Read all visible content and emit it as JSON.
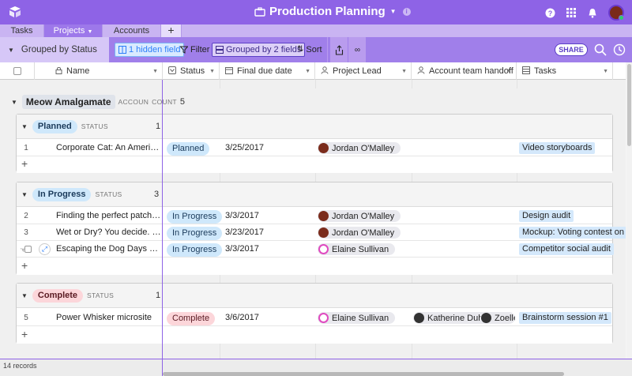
{
  "app": {
    "title": "Production Planning",
    "colors": {
      "topbar": "#8e63e6",
      "accent": "#2d7ff9",
      "frozen_line": "#8e63e6"
    }
  },
  "tabs": [
    {
      "label": "Tasks"
    },
    {
      "label": "Projects",
      "active": true
    },
    {
      "label": "Accounts"
    }
  ],
  "tab_add": "+",
  "toolbar": {
    "view_name": "Grouped by Status",
    "hidden_fields": "1 hidden field",
    "filter": "Filter",
    "grouped": "Grouped by 2 fields",
    "sort": "Sort",
    "share": "SHARE"
  },
  "columns": [
    {
      "label": "Name",
      "icon": "lock-icon"
    },
    {
      "label": "Status",
      "icon": "single-select-icon"
    },
    {
      "label": "Final due date",
      "icon": "calendar-icon"
    },
    {
      "label": "Project Lead",
      "icon": "user-icon"
    },
    {
      "label": "Account team handoff",
      "icon": "user-icon"
    },
    {
      "label": "Tasks",
      "icon": "linked-records-icon"
    }
  ],
  "top_group": {
    "label": "Meow Amalgamate",
    "field": "ACCOUN",
    "count_label": "COUNT",
    "count": "5"
  },
  "groups": [
    {
      "label": "Planned",
      "field": "STATUS",
      "count": "1",
      "color": "blue",
      "rows": [
        {
          "num": "1",
          "name": "Corporate Cat: An American L...",
          "status": "Planned",
          "date": "3/25/2017",
          "lead": "Jordan O'Malley",
          "lead_avatar": "dark",
          "handoff": [],
          "task": "Video storyboards"
        }
      ]
    },
    {
      "label": "In Progress",
      "field": "STATUS",
      "count": "3",
      "color": "blue",
      "rows": [
        {
          "num": "2",
          "name": "Finding the perfect patch of s...",
          "status": "In Progress",
          "date": "3/3/2017",
          "lead": "Jordan O'Malley",
          "lead_avatar": "dark",
          "handoff": [],
          "task": "Design audit"
        },
        {
          "num": "3",
          "name": "Wet or Dry? You decide. (Soci...",
          "status": "In Progress",
          "date": "3/23/2017",
          "lead": "Jordan O'Malley",
          "lead_avatar": "dark",
          "handoff": [],
          "task": "Mockup: Voting contest on"
        },
        {
          "num": "",
          "name": "Escaping the Dog Days of Sum...",
          "status": "In Progress",
          "date": "3/3/2017",
          "lead": "Elaine Sullivan",
          "lead_avatar": "pink",
          "handoff": [],
          "task": "Competitor social audit",
          "hover": true
        }
      ]
    },
    {
      "label": "Complete",
      "field": "STATUS",
      "count": "1",
      "color": "red",
      "rows": [
        {
          "num": "5",
          "name": "Power Whisker microsite",
          "status": "Complete",
          "date": "3/6/2017",
          "lead": "Elaine Sullivan",
          "lead_avatar": "pink",
          "handoff": [
            "Katherine Duh",
            "Zoelle"
          ],
          "task": "Brainstorm session #1"
        }
      ]
    }
  ],
  "add_row": "+",
  "footer": {
    "records": "14 records"
  }
}
